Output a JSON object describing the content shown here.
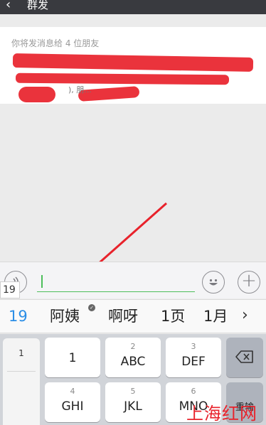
{
  "header": {
    "back_glyph": "‹",
    "title": "群发"
  },
  "recipients": {
    "label": "你将发消息给 4 位朋友",
    "names_fragment": "), 朋..."
  },
  "composer": {
    "voice_icon": "voice-icon",
    "emoji_icon": "emoji-icon",
    "plus_icon": "plus-icon",
    "input_value": "",
    "pinyin_preview": "19"
  },
  "candidates": {
    "items": [
      "19",
      "阿姨",
      "啊呀",
      "1页",
      "1月"
    ],
    "more_glyph": "›"
  },
  "keyboard": {
    "side_list": [
      "1"
    ],
    "keys": [
      {
        "num": "",
        "letters": "1"
      },
      {
        "num": "2",
        "letters": "ABC"
      },
      {
        "num": "3",
        "letters": "DEF"
      },
      {
        "num": "4",
        "letters": "GHI"
      },
      {
        "num": "5",
        "letters": "JKL"
      },
      {
        "num": "6",
        "letters": "MNO"
      }
    ],
    "delete_icon": "backspace-icon",
    "reenter_label": "重输"
  },
  "watermark": "上海红网",
  "colors": {
    "accent_green": "#4cbe5a",
    "candidate_blue": "#2b8ee6",
    "redaction_red": "#e8222b",
    "topbar": "#393a3f"
  }
}
